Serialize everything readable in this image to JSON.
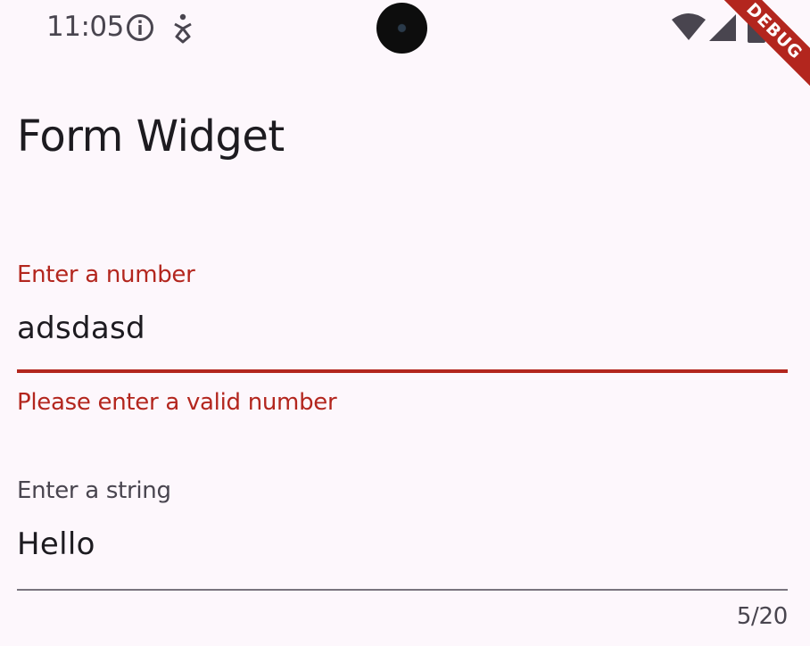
{
  "status_bar": {
    "time": "11:05",
    "icons": [
      "info-icon",
      "accessibility-icon",
      "wifi-icon",
      "signal-icon",
      "battery-icon"
    ]
  },
  "debug_banner": {
    "label": "DEBUG",
    "color": "#b3261e"
  },
  "app_bar": {
    "title": "Form Widget"
  },
  "form": {
    "number_field": {
      "label": "Enter a number",
      "value": "adsdasd",
      "error": "Please enter a valid number",
      "error_color": "#b3261e"
    },
    "string_field": {
      "label": "Enter a string",
      "value": "Hello",
      "counter": "5/20"
    }
  },
  "colors": {
    "background": "#fdf7fc",
    "error": "#b3261e",
    "text": "#1d1b20",
    "secondary_text": "#49454f"
  }
}
